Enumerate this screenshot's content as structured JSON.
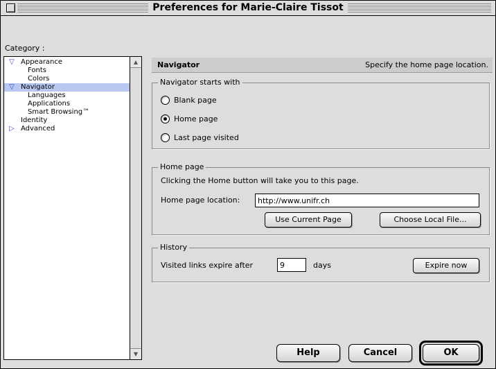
{
  "window": {
    "title": "Preferences for Marie-Claire Tissot"
  },
  "category": {
    "label": "Category :",
    "items": [
      {
        "label": "Appearance",
        "expander": "expanded-triangle-icon",
        "level": 0,
        "selected": false
      },
      {
        "label": "Fonts",
        "level": 1,
        "selected": false
      },
      {
        "label": "Colors",
        "level": 1,
        "selected": false
      },
      {
        "label": "Navigator",
        "expander": "expanded-triangle-icon",
        "level": 0,
        "selected": true
      },
      {
        "label": "Languages",
        "level": 1,
        "selected": false
      },
      {
        "label": "Applications",
        "level": 1,
        "selected": false
      },
      {
        "label": "Smart Browsing™",
        "level": 1,
        "selected": false
      },
      {
        "label": "Identity",
        "level": 0,
        "selected": false
      },
      {
        "label": "Advanced",
        "expander": "collapsed-triangle-icon",
        "level": 0,
        "selected": false
      }
    ]
  },
  "panel": {
    "title": "Navigator",
    "description": "Specify the home page location."
  },
  "starts_with": {
    "legend": "Navigator starts with",
    "options": [
      {
        "label": "Blank page",
        "checked": false
      },
      {
        "label": "Home page",
        "checked": true
      },
      {
        "label": "Last page visited",
        "checked": false
      }
    ]
  },
  "home_page": {
    "legend": "Home page",
    "info": "Clicking the Home button will take you to this page.",
    "location_label": "Home page location:",
    "location_value": "http://www.unifr.ch",
    "use_current_label": "Use Current Page",
    "choose_local_label": "Choose Local File..."
  },
  "history": {
    "legend": "History",
    "expire_label": "Visited links expire after",
    "expire_value": "9",
    "days_label": "days",
    "expire_now_label": "Expire now"
  },
  "buttons": {
    "help": "Help",
    "cancel": "Cancel",
    "ok": "OK"
  },
  "colors": {
    "selection": "#b8c8f0",
    "triangle": "#3a46c8"
  }
}
